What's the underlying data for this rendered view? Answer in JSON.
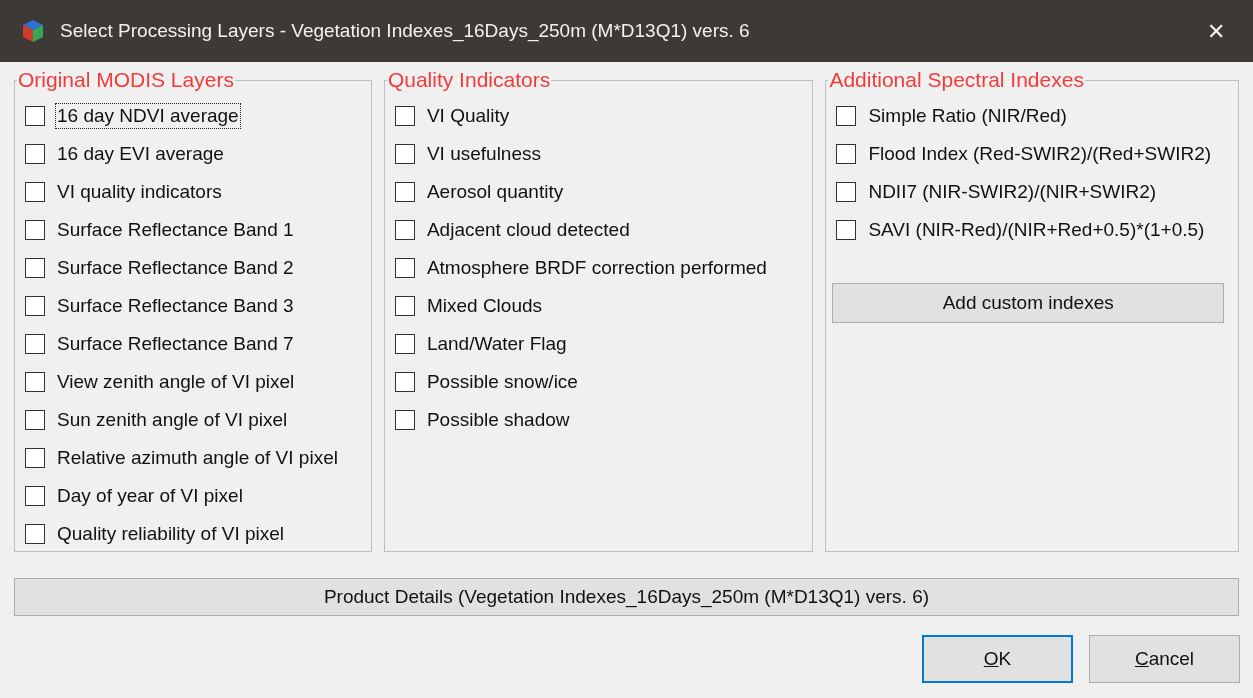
{
  "window": {
    "title": "Select Processing Layers -  Vegetation Indexes_16Days_250m (M*D13Q1) vers. 6",
    "close": "✕"
  },
  "groups": [
    {
      "title": "Original MODIS Layers",
      "items": [
        {
          "label": "16 day NDVI average",
          "checked": false,
          "focused": true
        },
        {
          "label": "16 day EVI average",
          "checked": false,
          "focused": false
        },
        {
          "label": "VI quality indicators",
          "checked": false,
          "focused": false
        },
        {
          "label": "Surface Reflectance Band 1",
          "checked": false,
          "focused": false
        },
        {
          "label": "Surface Reflectance Band 2",
          "checked": false,
          "focused": false
        },
        {
          "label": "Surface Reflectance Band 3",
          "checked": false,
          "focused": false
        },
        {
          "label": "Surface Reflectance Band 7",
          "checked": false,
          "focused": false
        },
        {
          "label": "View zenith angle of VI pixel",
          "checked": false,
          "focused": false
        },
        {
          "label": "Sun zenith angle of VI pixel",
          "checked": false,
          "focused": false
        },
        {
          "label": "Relative azimuth angle of VI pixel",
          "checked": false,
          "focused": false
        },
        {
          "label": "Day of year of VI pixel",
          "checked": false,
          "focused": false
        },
        {
          "label": "Quality reliability of VI pixel",
          "checked": false,
          "focused": false
        }
      ]
    },
    {
      "title": "Quality Indicators",
      "items": [
        {
          "label": "VI Quality",
          "checked": false,
          "focused": false
        },
        {
          "label": "VI usefulness",
          "checked": false,
          "focused": false
        },
        {
          "label": "Aerosol quantity",
          "checked": false,
          "focused": false
        },
        {
          "label": "Adjacent cloud detected",
          "checked": false,
          "focused": false
        },
        {
          "label": "Atmosphere BRDF correction performed",
          "checked": false,
          "focused": false
        },
        {
          "label": "Mixed Clouds",
          "checked": false,
          "focused": false
        },
        {
          "label": "Land/Water Flag",
          "checked": false,
          "focused": false
        },
        {
          "label": "Possible snow/ice",
          "checked": false,
          "focused": false
        },
        {
          "label": "Possible shadow",
          "checked": false,
          "focused": false
        }
      ]
    },
    {
      "title": "Additional Spectral Indexes",
      "items": [
        {
          "label": "Simple Ratio (NIR/Red)",
          "checked": false,
          "focused": false
        },
        {
          "label": "Flood Index (Red-SWIR2)/(Red+SWIR2)",
          "checked": false,
          "focused": false
        },
        {
          "label": "NDII7 (NIR-SWIR2)/(NIR+SWIR2)",
          "checked": false,
          "focused": false
        },
        {
          "label": "SAVI (NIR-Red)/(NIR+Red+0.5)*(1+0.5)",
          "checked": false,
          "focused": false
        }
      ],
      "button": "Add custom indexes"
    }
  ],
  "details_button": "Product Details  (Vegetation Indexes_16Days_250m (M*D13Q1) vers. 6)",
  "buttons": [
    {
      "accel": "O",
      "rest": "K",
      "default": true
    },
    {
      "accel": "C",
      "rest": "ancel",
      "default": false
    }
  ]
}
